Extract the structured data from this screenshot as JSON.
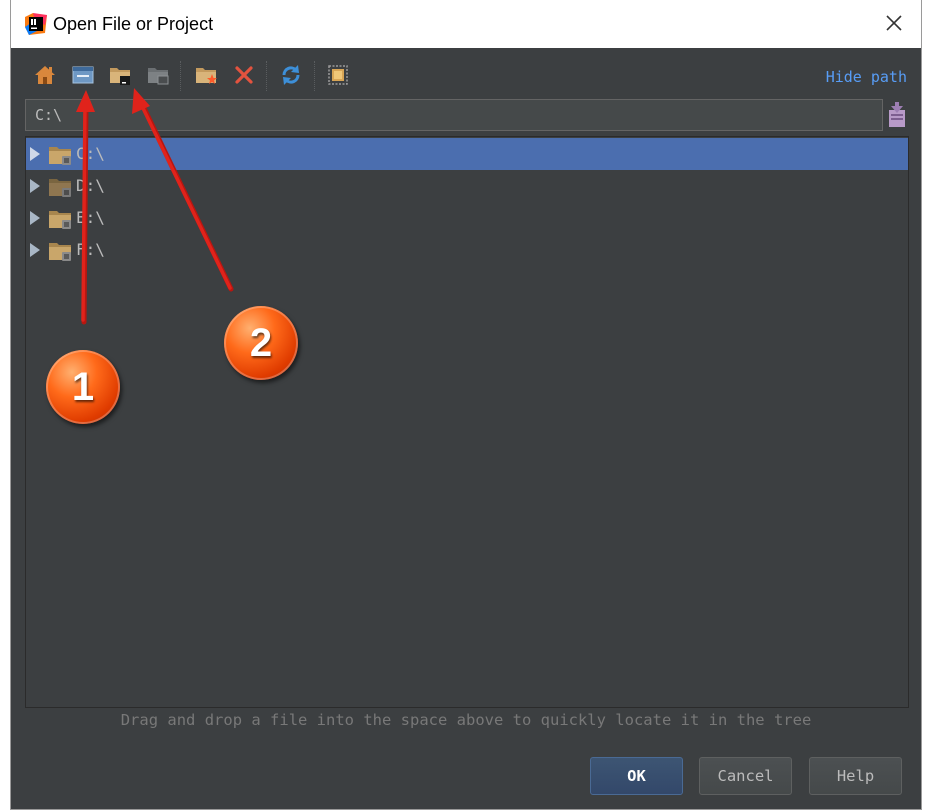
{
  "window": {
    "title": "Open File or Project",
    "close_icon": "close-icon"
  },
  "toolbar": {
    "buttons": [
      {
        "icon": "home-icon"
      },
      {
        "icon": "desktop-icon"
      },
      {
        "icon": "project-folder-icon"
      },
      {
        "icon": "module-folder-icon"
      },
      {
        "icon": "new-folder-icon"
      },
      {
        "icon": "delete-icon"
      },
      {
        "icon": "refresh-icon"
      },
      {
        "icon": "show-hidden-files-icon"
      }
    ],
    "hide_path_label": "Hide path"
  },
  "path": {
    "value": "C:\\",
    "history_icon": "path-history-icon"
  },
  "tree": {
    "items": [
      {
        "label": "C:\\",
        "selected": true
      },
      {
        "label": "D:\\",
        "selected": false
      },
      {
        "label": "E:\\",
        "selected": false
      },
      {
        "label": "F:\\",
        "selected": false
      }
    ]
  },
  "hint": "Drag and drop a file into the space above to quickly locate it in the tree",
  "buttons": {
    "ok": "OK",
    "cancel": "Cancel",
    "help": "Help"
  },
  "annotations": {
    "badge1": "1",
    "badge2": "2",
    "color": "#e0231b"
  },
  "colors": {
    "background": "#3c3f41",
    "selection": "#4b6eaf",
    "link": "#589df6"
  }
}
